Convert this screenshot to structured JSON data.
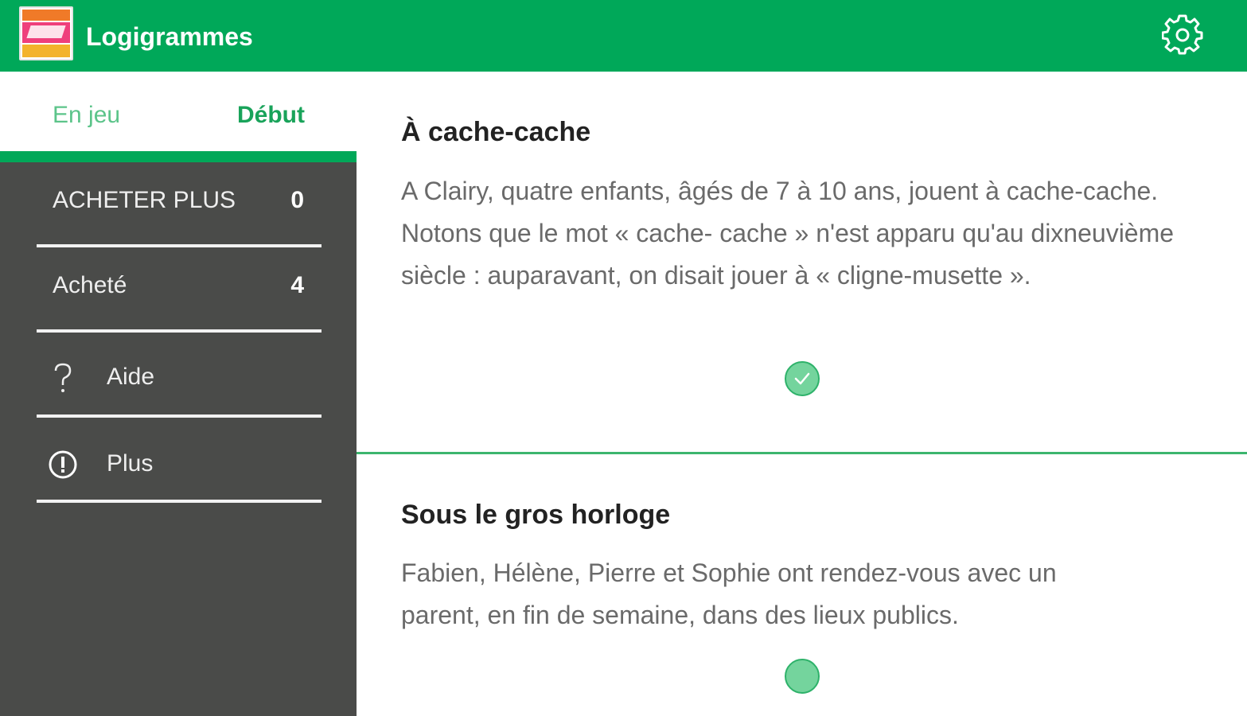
{
  "appbar": {
    "title": "Logigrammes",
    "logo_icon": "app-logo",
    "settings_icon": "gear-icon",
    "color": "#00a859"
  },
  "sidebar": {
    "tabs": [
      {
        "label": "En jeu",
        "active": false
      },
      {
        "label": "Début",
        "active": true
      }
    ],
    "items": [
      {
        "label": "ACHETER PLUS",
        "count": "0"
      },
      {
        "label": "Acheté",
        "count": "4"
      },
      {
        "label": "Aide",
        "icon": "help-icon"
      },
      {
        "label": "Plus",
        "icon": "info-icon"
      }
    ]
  },
  "puzzles": [
    {
      "title": "À cache-cache",
      "description": "A Clairy, quatre enfants, âgés de 7 à 10 ans, jouent à cache-cache. Notons que le mot « cache- cache » n'est apparu qu'au dixneuvième siècle : auparavant, on disait jouer à « cligne-musette ».",
      "status_icon": "check-circle-icon",
      "completed": true
    },
    {
      "title": "Sous le gros horloge",
      "description": "Fabien, Hélène, Pierre et Sophie ont rendez-vous avec un parent, en fin de semaine, dans des lieux publics.",
      "status_icon": "circle-icon",
      "completed": false
    }
  ]
}
